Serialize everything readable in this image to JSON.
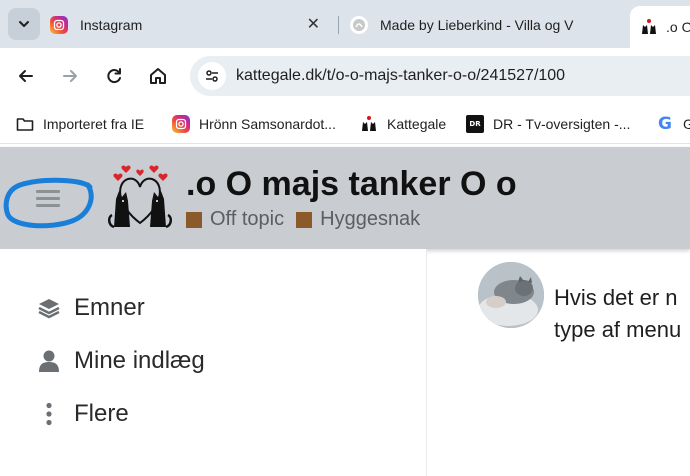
{
  "tabs": [
    {
      "title": "Instagram",
      "icon": "instagram-icon"
    },
    {
      "title": "Made by Lieberkind - Villa og V",
      "icon": "lieberkind-icon"
    },
    {
      "title": ".o O",
      "icon": "kattegale-icon",
      "active": true
    }
  ],
  "address": {
    "url": "kattegale.dk/t/o-o-majs-tanker-o-o/241527/100"
  },
  "bookmarks": [
    {
      "label": "Importeret fra IE",
      "icon": "folder-icon"
    },
    {
      "label": "Hrönn Samsonardot...",
      "icon": "instagram-icon"
    },
    {
      "label": "Kattegale",
      "icon": "kattegale-icon"
    },
    {
      "label": "DR - Tv-oversigten -...",
      "icon": "dr-icon"
    },
    {
      "label": "G",
      "icon": "google-icon"
    }
  ],
  "header": {
    "title": ".o O majs tanker O o",
    "categories": [
      {
        "label": "Off topic",
        "color": "#8a5a2b"
      },
      {
        "label": "Hyggesnak",
        "color": "#8a5a2b"
      }
    ]
  },
  "sidebar": {
    "items": [
      {
        "label": "Emner",
        "icon": "layers-icon"
      },
      {
        "label": "Mine indlæg",
        "icon": "user-icon"
      },
      {
        "label": "Flere",
        "icon": "more-vertical-icon"
      }
    ]
  },
  "post": {
    "lines": [
      "Hvis det er n",
      "type af menu"
    ]
  },
  "colors": {
    "tabstrip": "#dde3ea",
    "header_bg": "#c9cdd2",
    "annotation_circle": "#1a7fd9",
    "category_square": "#8a5a2b"
  }
}
